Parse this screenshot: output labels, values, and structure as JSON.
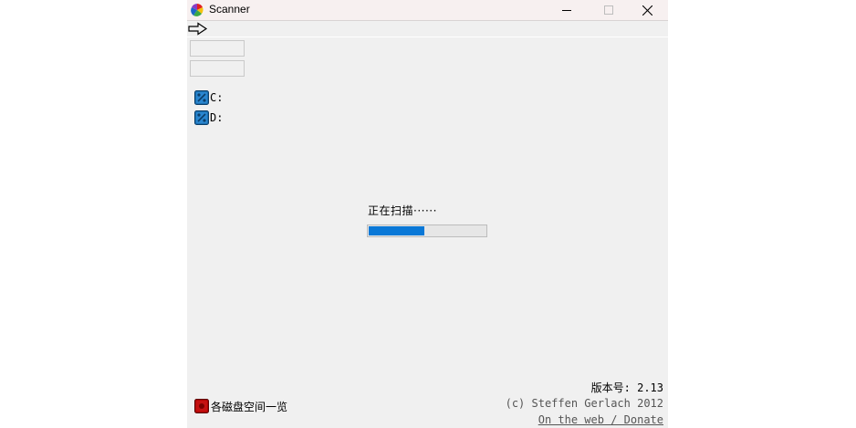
{
  "window": {
    "title": "Scanner"
  },
  "toolbar": {
    "forward_icon": "arrow-right-outline-icon"
  },
  "inputs": [
    {
      "value": "",
      "placeholder": ""
    },
    {
      "value": "",
      "placeholder": ""
    }
  ],
  "drives": [
    {
      "label": "C:",
      "icon": "drive-icon"
    },
    {
      "label": "D:",
      "icon": "drive-icon"
    }
  ],
  "status": {
    "text": "正在扫描······",
    "progress": 0.48
  },
  "footer": {
    "version": "版本号:  2.13",
    "copyright": "(c) Steffen Gerlach 2012",
    "link": "On the web / Donate",
    "overview_label": "各磁盘空间一览"
  },
  "colors": {
    "progress_fill": "#0a78d7",
    "drive_icon": "#1b6fb0",
    "overview_icon": "#b00000",
    "window_bg": "#f0f0f0"
  }
}
